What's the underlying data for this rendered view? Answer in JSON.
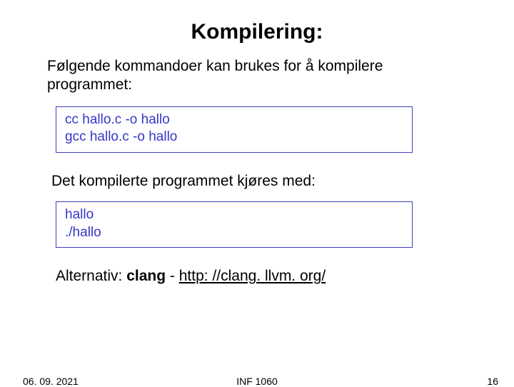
{
  "title": "Kompilering:",
  "intro": "Følgende kommandoer kan brukes for å kompilere programmet:",
  "compile_box": {
    "lines": [
      "cc hallo.c -o hallo",
      "gcc hallo.c -o hallo"
    ]
  },
  "run_intro": "Det kompilerte programmet kjøres med:",
  "run_box": {
    "lines": [
      "hallo",
      "./hallo"
    ]
  },
  "alt": {
    "prefix": "Alternativ: ",
    "name": "clang",
    "sep": " - ",
    "link": "http: //clang. llvm. org/"
  },
  "footer": {
    "date": "06. 09. 2021",
    "course": "INF 1060",
    "page": "16"
  }
}
